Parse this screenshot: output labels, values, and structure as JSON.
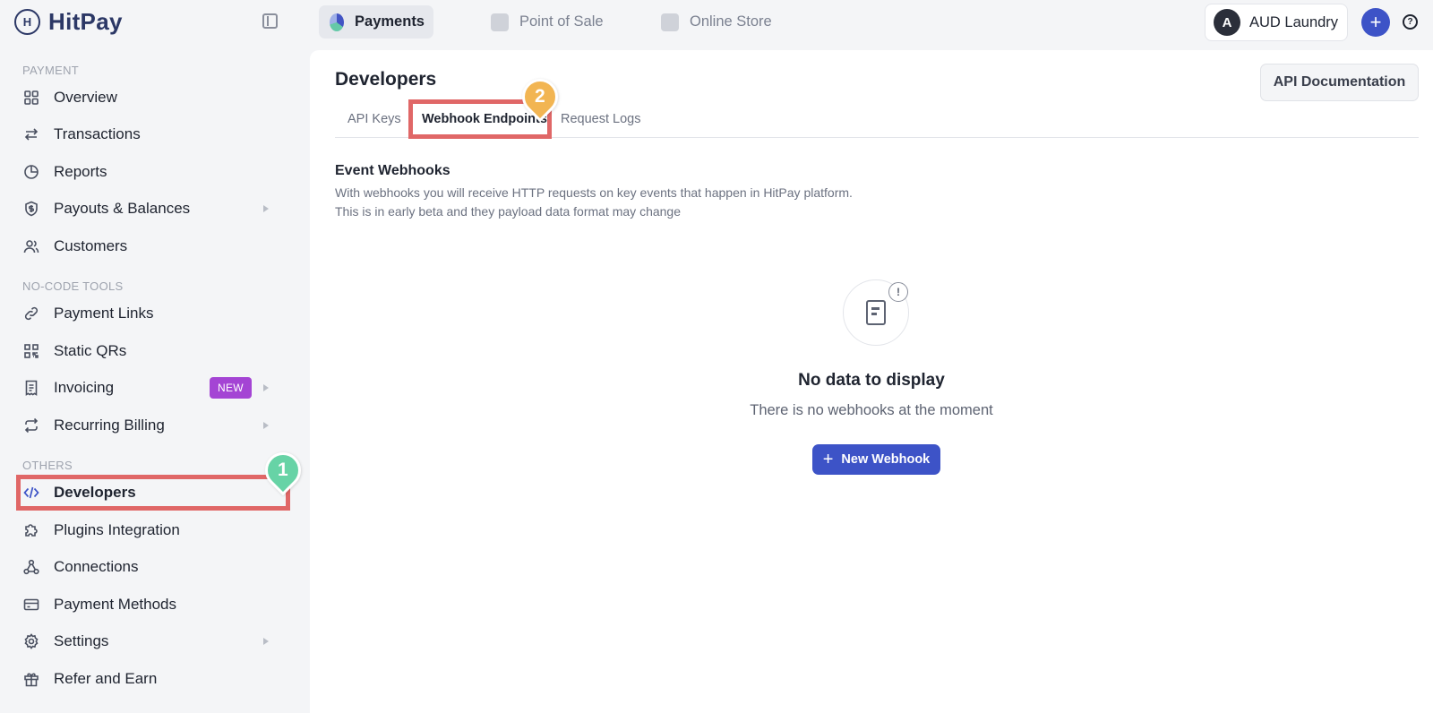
{
  "topbar": {
    "logo_text": "HitPay",
    "logo_mark": "H",
    "apps": [
      {
        "label": "Payments",
        "icon": "payments-icon",
        "active": true
      },
      {
        "label": "Point of Sale",
        "icon": "pos-icon",
        "active": false
      },
      {
        "label": "Online Store",
        "icon": "store-icon",
        "active": false
      }
    ],
    "account": {
      "initial": "A",
      "name": "AUD Laundry"
    },
    "plus_label": "+",
    "help_label": "?"
  },
  "sidebar": {
    "sections": {
      "payment": "PAYMENT",
      "nocode": "NO-CODE TOOLS",
      "others": "OTHERS"
    },
    "items": [
      {
        "label": "Overview",
        "icon": "grid-icon"
      },
      {
        "label": "Transactions",
        "icon": "arrows-swap-icon"
      },
      {
        "label": "Reports",
        "icon": "pie-chart-icon"
      },
      {
        "label": "Payouts & Balances",
        "icon": "shield-dollar-icon",
        "has_submenu": true
      },
      {
        "label": "Customers",
        "icon": "users-icon"
      },
      {
        "label": "Payment Links",
        "icon": "link-icon"
      },
      {
        "label": "Static QRs",
        "icon": "qr-icon"
      },
      {
        "label": "Invoicing",
        "icon": "invoice-icon",
        "badge": "NEW",
        "has_submenu": true
      },
      {
        "label": "Recurring Billing",
        "icon": "repeat-icon",
        "has_submenu": true
      },
      {
        "label": "Developers",
        "icon": "code-icon",
        "selected": true
      },
      {
        "label": "Plugins Integration",
        "icon": "puzzle-icon"
      },
      {
        "label": "Connections",
        "icon": "network-icon"
      },
      {
        "label": "Payment Methods",
        "icon": "card-icon"
      },
      {
        "label": "Settings",
        "icon": "gear-icon",
        "has_submenu": true
      },
      {
        "label": "Refer and Earn",
        "icon": "gift-icon"
      }
    ]
  },
  "annotations": {
    "step1": "1",
    "step2": "2"
  },
  "main": {
    "title": "Developers",
    "api_doc_button": "API Documentation",
    "tabs": [
      {
        "label": "API Keys",
        "active": false
      },
      {
        "label": "Webhook Endpoints",
        "active": true
      },
      {
        "label": "Request Logs",
        "active": false
      }
    ],
    "section_title": "Event Webhooks",
    "section_desc_1": "With webhooks you will receive HTTP requests on key events that happen in HitPay platform.",
    "section_desc_2": "This is in early beta and they payload data format may change",
    "empty": {
      "title": "No data to display",
      "subtitle": "There is no webhooks at the moment",
      "alert_mark": "!",
      "button_label": "New Webhook",
      "button_plus": "+"
    }
  },
  "colors": {
    "brand_navy": "#2c3866",
    "primary_button": "#3d53c7",
    "badge_purple": "#a444d4",
    "highlight_red": "#e06767",
    "marker_green": "#67d3a6",
    "marker_orange": "#f2b552"
  }
}
